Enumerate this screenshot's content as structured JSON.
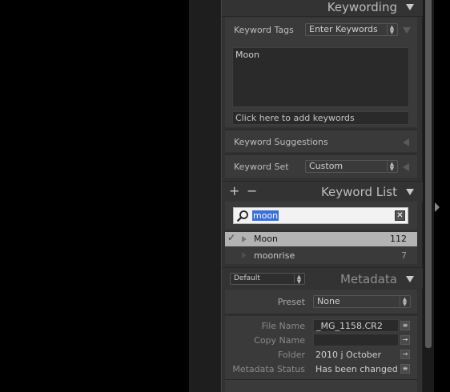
{
  "keywording": {
    "title": "Keywording",
    "keyword_tags_label": "Keyword Tags",
    "keyword_tags_mode": "Enter Keywords",
    "keywords_text": "Moon",
    "add_keywords_placeholder": "Click here to add keywords",
    "suggestions_label": "Keyword Suggestions",
    "keyword_set_label": "Keyword Set",
    "keyword_set_value": "Custom"
  },
  "keyword_list": {
    "title": "Keyword List",
    "add_symbol": "+",
    "remove_symbol": "−",
    "search_value": "moon",
    "rows": [
      {
        "name": "Moon",
        "count": "112",
        "checked": true,
        "selected": true
      },
      {
        "name": "moonrise",
        "count": "7",
        "checked": false,
        "selected": false
      }
    ]
  },
  "metadata": {
    "title": "Metadata",
    "view_preset": "Default",
    "preset_label": "Preset",
    "preset_value": "None",
    "fields": [
      {
        "label": "File Name",
        "value": "_MG_1158.CR2",
        "button": "list-icon"
      },
      {
        "label": "Copy Name",
        "value": "",
        "button": "arrow-right-icon"
      },
      {
        "label": "Folder",
        "value": "2010 j October",
        "button": "arrow-right-icon"
      },
      {
        "label": "Metadata Status",
        "value": "Has been changed",
        "button": "list-icon"
      }
    ]
  },
  "colors": {
    "panel": "#323232",
    "selected_row": "#b3b3b3",
    "search_highlight": "#3a6fd8"
  }
}
